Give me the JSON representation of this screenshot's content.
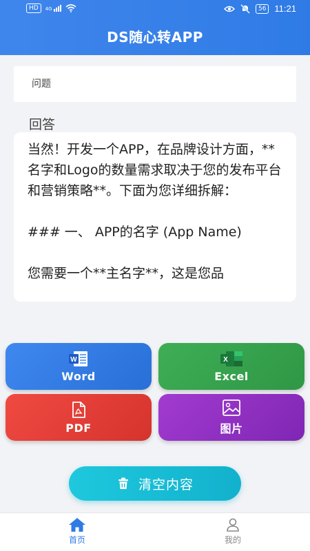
{
  "status_bar": {
    "network": "HD",
    "signal": "4G",
    "battery": "56",
    "time": "11:21"
  },
  "header": {
    "title": "DS随心转APP"
  },
  "question": {
    "placeholder": "问题"
  },
  "answer": {
    "label": "回答",
    "text": "当然！开发一个APP，在品牌设计方面，**名字和Logo的数量需求取决于您的发布平台和营销策略**。下面为您详细拆解：\n\n### 一、 APP的名字 (App Name)\n\n您需要一个**主名字**，这是您品"
  },
  "buttons": {
    "word": "Word",
    "excel": "Excel",
    "pdf": "PDF",
    "image": "图片"
  },
  "clear": {
    "label": "清空内容"
  },
  "nav": {
    "home": "首页",
    "mine": "我的"
  },
  "colors": {
    "header": "#2f7be6",
    "word": "#2f7be6",
    "excel": "#36a24d",
    "pdf": "#e3403a",
    "image": "#9232c4",
    "clear": "#17bdd5",
    "nav_active": "#2f7be6"
  }
}
